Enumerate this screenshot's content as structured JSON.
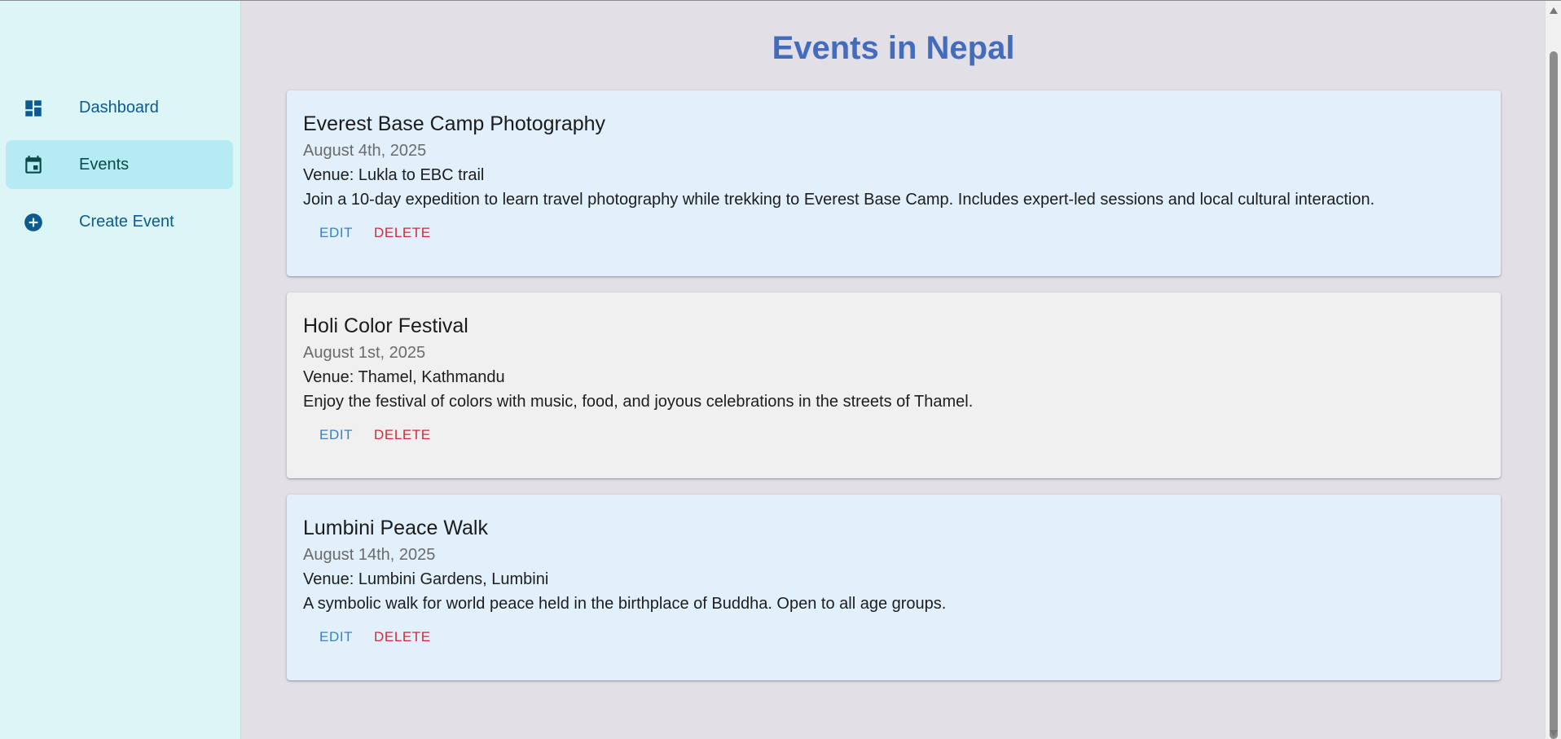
{
  "sidebar": {
    "items": [
      {
        "label": "Dashboard",
        "icon": "dashboard-icon",
        "active": false
      },
      {
        "label": "Events",
        "icon": "calendar-icon",
        "active": true
      },
      {
        "label": "Create Event",
        "icon": "add-circle-icon",
        "active": false
      }
    ]
  },
  "main": {
    "title": "Events in Nepal",
    "events": [
      {
        "title": "Everest Base Camp Photography",
        "date": "August 4th, 2025",
        "venue": "Venue: Lukla to EBC trail",
        "description": "Join a 10-day expedition to learn travel photography while trekking to Everest Base Camp. Includes expert-led sessions and local cultural interaction.",
        "edit_label": "EDIT",
        "delete_label": "DELETE"
      },
      {
        "title": "Holi Color Festival",
        "date": "August 1st, 2025",
        "venue": "Venue: Thamel, Kathmandu",
        "description": "Enjoy the festival of colors with music, food, and joyous celebrations in the streets of Thamel.",
        "edit_label": "EDIT",
        "delete_label": "DELETE"
      },
      {
        "title": "Lumbini Peace Walk",
        "date": "August 14th, 2025",
        "venue": "Venue: Lumbini Gardens, Lumbini",
        "description": "A symbolic walk for world peace held in the birthplace of Buddha. Open to all age groups.",
        "edit_label": "EDIT",
        "delete_label": "DELETE"
      }
    ]
  },
  "colors": {
    "title": "#436cbd",
    "nav_text": "#0c5a8f",
    "edit": "#3a82c4",
    "delete": "#cd2d3a",
    "card_blue": "#e1f0fb",
    "card_grey": "#f0f0f0",
    "sidebar_bg": "#dcf6f8",
    "active_bg": "#b5ebf2"
  }
}
